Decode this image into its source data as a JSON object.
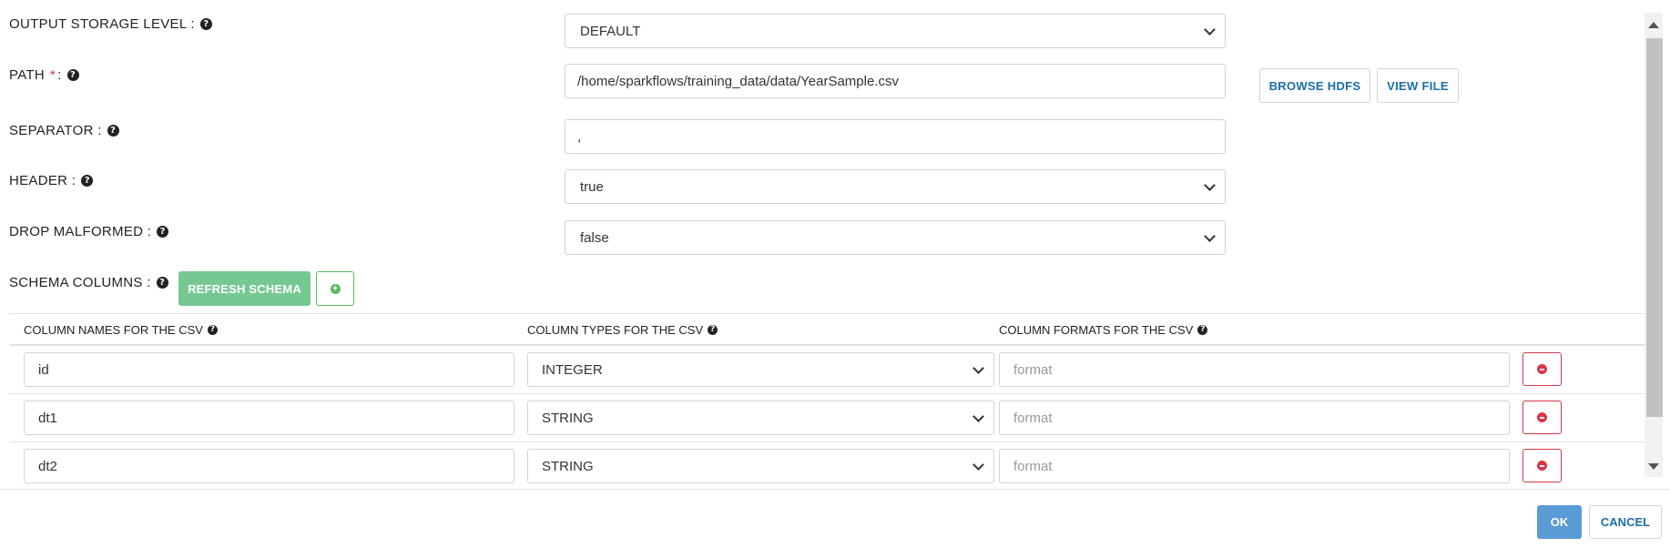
{
  "form": {
    "output_storage_level": {
      "label": "OUTPUT STORAGE LEVEL :",
      "value": "DEFAULT"
    },
    "path": {
      "label": "PATH",
      "required_mark": "*",
      "colon": ":",
      "value": "/home/sparkflows/training_data/data/YearSample.csv",
      "browse_label": "BROWSE HDFS",
      "view_label": "VIEW FILE"
    },
    "separator": {
      "label": "SEPARATOR :",
      "value": ","
    },
    "header": {
      "label": "HEADER :",
      "value": "true"
    },
    "drop_malformed": {
      "label": "DROP MALFORMED :",
      "value": "false"
    },
    "schema_columns": {
      "label": "SCHEMA COLUMNS :",
      "refresh_label": "REFRESH SCHEMA"
    }
  },
  "table": {
    "headers": [
      "COLUMN NAMES FOR THE CSV",
      "COLUMN TYPES FOR THE CSV",
      "COLUMN FORMATS FOR THE CSV"
    ],
    "format_placeholder": "format",
    "rows": [
      {
        "name": "id",
        "type": "INTEGER"
      },
      {
        "name": "dt1",
        "type": "STRING"
      },
      {
        "name": "dt2",
        "type": "STRING"
      }
    ]
  },
  "footer": {
    "ok_label": "OK",
    "cancel_label": "CANCEL"
  },
  "icons": {
    "help": "question-circle-icon",
    "add": "plus-circle-icon",
    "remove": "minus-circle-icon",
    "dropdown": "chevron-down-icon"
  },
  "colors": {
    "primary": "#5b9bd5",
    "success": "#76c893",
    "danger": "#dc3545",
    "link": "#1a6fa8"
  }
}
